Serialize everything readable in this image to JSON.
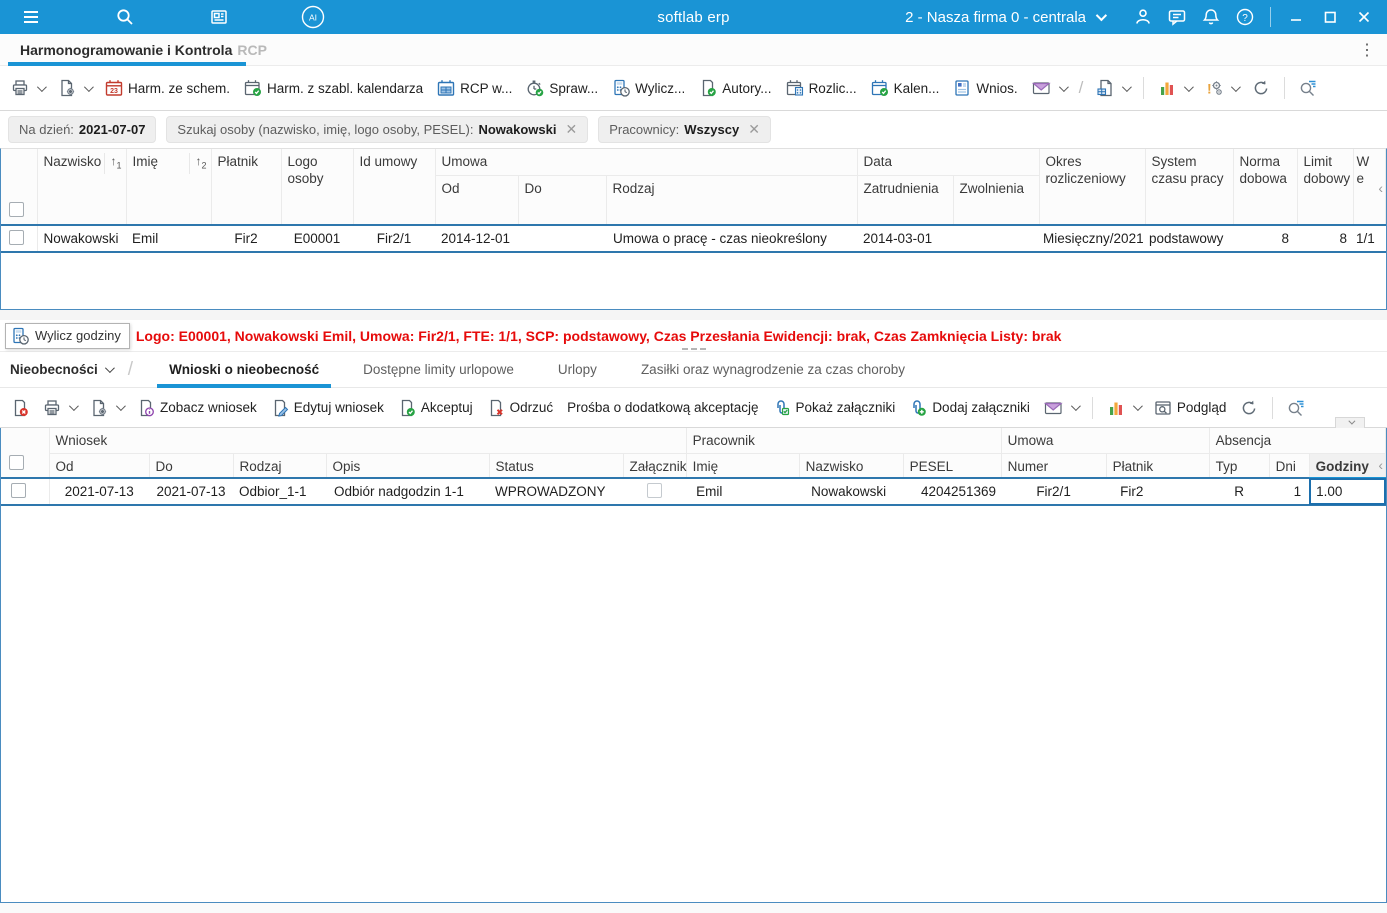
{
  "titlebar": {
    "app_title": "softlab erp",
    "company": "2 - Nasza firma 0 - centrala"
  },
  "page_tab": {
    "title_main": "Harmonogramowanie i Kontrola",
    "title_dim": "RCP"
  },
  "toolbar1": {
    "harm_ze_schem": "Harm. ze schem.",
    "harm_z_szabl": "Harm. z szabl. kalendarza",
    "rcp": "RCP w...",
    "spraw": "Spraw...",
    "wylicz": "Wylicz...",
    "autory": "Autory...",
    "rozlic": "Rozlic...",
    "kalen": "Kalen...",
    "wnios": "Wnios."
  },
  "filters": {
    "na_dzien_label": "Na dzień:",
    "na_dzien_value": "2021-07-07",
    "szukaj_label": "Szukaj osoby (nazwisko, imię, logo osoby, PESEL):",
    "szukaj_value": "Nowakowski",
    "pracownicy_label": "Pracownicy:",
    "pracownicy_value": "Wszyscy"
  },
  "grid1": {
    "header": {
      "nazwisko": "Nazwisko",
      "imie": "Imię",
      "platnik": "Płatnik",
      "logo_osoby": "Logo osoby",
      "id_umowy": "Id umowy",
      "umowa": "Umowa",
      "od": "Od",
      "do": "Do",
      "rodzaj": "Rodzaj",
      "data": "Data",
      "zatrudnienia": "Zatrudnienia",
      "zwolnienia": "Zwolnienia",
      "okres": "Okres rozliczeniowy",
      "system": "System czasu pracy",
      "norma": "Norma dobowa",
      "limit": "Limit dobowy",
      "wymiar_l1": "W",
      "wymiar_l2": "e"
    },
    "row": {
      "nazwisko": "Nowakowski",
      "imie": "Emil",
      "platnik": "Fir2",
      "logo_osoby": "E00001",
      "id_umowy": "Fir2/1",
      "od": "2014-12-01",
      "do": "",
      "rodzaj": "Umowa o pracę - czas nieokreślony",
      "zatrudnienia": "2014-03-01",
      "zwolnienia": "",
      "okres": "Miesięczny/2021",
      "system": "podstawowy",
      "norma": "8",
      "limit": "8",
      "wymiar": "1/1"
    }
  },
  "status_line": {
    "tooltip": "Wylicz godziny",
    "message": "Logo: E00001, Nowakowski Emil, Umowa: Fir2/1, FTE: 1/1, SCP: podstawowy, Czas Przesłania Ewidencji: brak, Czas Zamknięcia Listy: brak"
  },
  "section_tabs": {
    "selector": "Nieobecności",
    "tabs": [
      "Wnioski o nieobecność",
      "Dostępne limity urlopowe",
      "Urlopy",
      "Zasiłki oraz wynagrodzenie za czas choroby"
    ],
    "active_index": 0
  },
  "toolbar2": {
    "zobacz": "Zobacz wniosek",
    "edytuj": "Edytuj wniosek",
    "akceptuj": "Akceptuj",
    "odrzuc": "Odrzuć",
    "prosba": "Prośba o dodatkową akceptację",
    "pokaz": "Pokaż załączniki",
    "dodaj": "Dodaj załączniki",
    "podglad": "Podgląd"
  },
  "grid2": {
    "groups": {
      "wniosek": "Wniosek",
      "pracownik": "Pracownik",
      "umowa": "Umowa",
      "absencja": "Absencja"
    },
    "header": {
      "od": "Od",
      "do": "Do",
      "rodzaj": "Rodzaj",
      "opis": "Opis",
      "status": "Status",
      "zalacznik": "Załącznik",
      "imie": "Imię",
      "nazwisko": "Nazwisko",
      "pesel": "PESEL",
      "numer": "Numer",
      "platnik": "Płatnik",
      "typ": "Typ",
      "dni": "Dni",
      "godziny": "Godziny"
    },
    "row": {
      "od": "2021-07-13",
      "do": "2021-07-13",
      "rodzaj": "Odbior_1-1",
      "opis": "Odbiór nadgodzin 1-1",
      "status": "WPROWADZONY",
      "imie": "Emil",
      "nazwisko": "Nowakowski",
      "pesel": "4204251369",
      "numer": "Fir2/1",
      "platnik": "Fir2",
      "typ": "R",
      "dni": "1",
      "godziny": "1.00"
    }
  },
  "icons": {
    "menu-icon": "hamburger",
    "search-icon": "magnifier",
    "news-icon": "newspaper",
    "ai-assistant-icon": "AI circle",
    "user-icon": "person",
    "chat-icon": "speech bubble",
    "notifications-icon": "bell",
    "help-icon": "question circle",
    "minimize-icon": "—",
    "maximize-icon": "▢",
    "close-icon": "✕",
    "printer-icon": "printer",
    "page-settings-icon": "page+gear",
    "calendar-23-icon": "red calendar 23",
    "calendar-check-icon": "calendar+check",
    "calendar-table-icon": "blue calendar grid",
    "stopwatch-check-icon": "stopwatch+check",
    "calculator-clock-icon": "calculator+clock",
    "document-check-icon": "doc+check",
    "calendar-calculator-icon": "calendar+calculator",
    "form-icon": "form",
    "envelope-icon": "envelope",
    "export-icon": "page+table",
    "bar-chart-icon": "green/orange/red bars",
    "gears-warning-icon": "gears+!",
    "refresh-icon": "circular arrow",
    "search-filter-icon": "magnifier+lines",
    "document-delete-icon": "doc+red x",
    "document-info-icon": "doc+i",
    "document-edit-icon": "doc+pencil",
    "document-accept-icon": "doc+check",
    "document-reject-icon": "doc+red x",
    "attachment-check-icon": "paperclip+check",
    "attachment-add-icon": "paperclip+plus",
    "preview-icon": "window+magnifier"
  },
  "colors": {
    "topbar": "#1a94d5",
    "accent": "#1a94d5",
    "grid_border": "#4a8cc0",
    "selected_row": "#2e77ad",
    "highlight": "#faf8d7",
    "alert": "#e60b0b"
  }
}
